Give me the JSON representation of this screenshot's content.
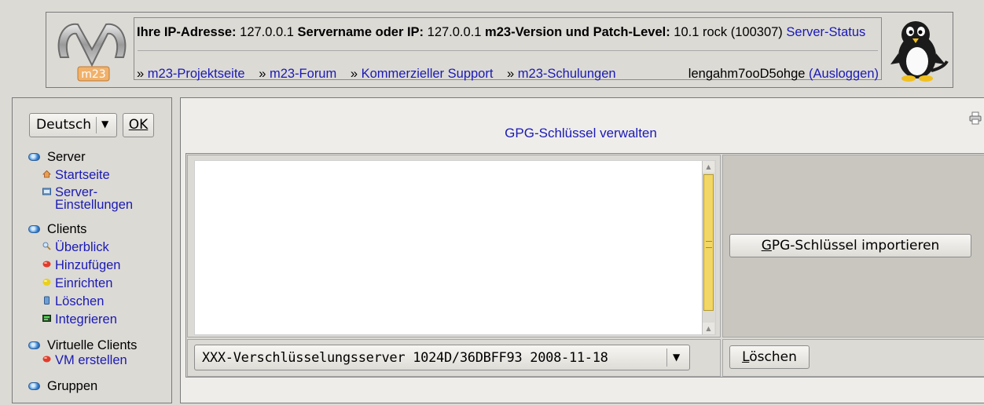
{
  "header": {
    "ip_label": "Ihre IP-Adresse:",
    "ip_value": "127.0.0.1",
    "server_label": "Servername oder IP:",
    "server_value": "127.0.0.1",
    "version_label": "m23-Version und Patch-Level:",
    "version_value": "10.1 rock (100307)",
    "server_status": "Server-Status",
    "links": [
      "m23-Projektseite",
      "m23-Forum",
      "Kommerzieller Support",
      "m23-Schulungen"
    ],
    "link_prefix": "»",
    "username": "lengahm7ooD5ohge",
    "logout": "(Ausloggen)",
    "logo_text": "m23"
  },
  "sidebar": {
    "language": "Deutsch",
    "ok_label": "OK",
    "groups": [
      {
        "title": "Server",
        "items": [
          {
            "label": "Startseite",
            "icon": "home-icon"
          },
          {
            "label": "Server-\nEinstellungen",
            "icon": "server-settings-icon"
          }
        ]
      },
      {
        "title": "Clients",
        "items": [
          {
            "label": "Überblick",
            "icon": "magnifier-icon"
          },
          {
            "label": "Hinzufügen",
            "icon": "red-ball-icon"
          },
          {
            "label": "Einrichten",
            "icon": "yellow-ball-icon"
          },
          {
            "label": "Löschen",
            "icon": "trash-icon"
          },
          {
            "label": "Integrieren",
            "icon": "integrate-icon"
          }
        ]
      },
      {
        "title": "Virtuelle Clients",
        "items": [
          {
            "label": "VM erstellen",
            "icon": "red-ball-icon"
          }
        ]
      },
      {
        "title": "Gruppen",
        "items": []
      }
    ]
  },
  "main": {
    "title": "GPG-Schlüssel verwalten",
    "import_button": "GPG-Schlüssel importieren",
    "import_accel": "G",
    "import_rest": "PG-Schlüssel importieren",
    "key_selected": "XXX-Verschlüsselungsserver 1024D/36DBFF93 2008-11-18",
    "delete_button": "Löschen",
    "delete_accel": "L",
    "delete_rest": "öschen",
    "textarea_value": ""
  },
  "colors": {
    "link": "#1a1ab4",
    "background": "#dcdad5",
    "scroll_thumb": "#f3d766"
  }
}
